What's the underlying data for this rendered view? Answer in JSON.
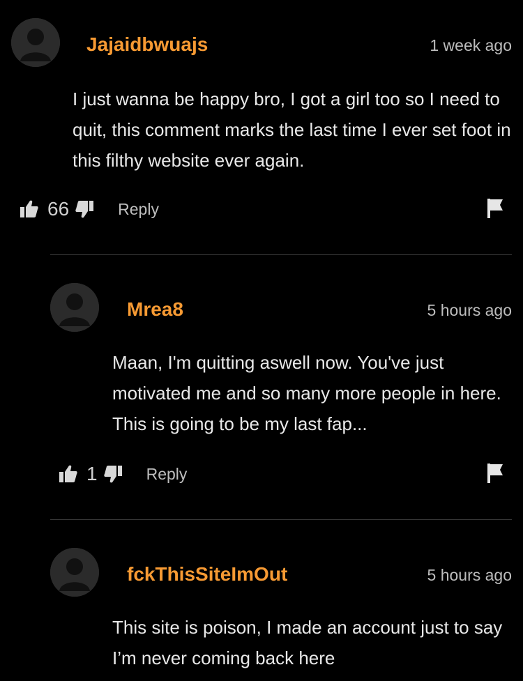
{
  "comments": [
    {
      "username": "Jajaidbwuajs",
      "timestamp": "1 week ago",
      "text": "I just wanna be happy bro, I got a girl too so I need to quit, this comment marks the last time I ever set foot in this filthy website ever again.",
      "likes": "66",
      "reply_label": "Reply"
    },
    {
      "username": "Mrea8",
      "timestamp": "5 hours ago",
      "text": "Maan, I'm quitting aswell now. You've just motivated me and so many more people in here. This is going to be my last fap...",
      "likes": "1",
      "reply_label": "Reply"
    },
    {
      "username": "fckThisSiteImOut",
      "timestamp": "5 hours ago",
      "text": "This site is poison, I made an account just to say I’m never coming back here"
    }
  ],
  "colors": {
    "background": "#000000",
    "username": "#f79a33",
    "text": "#e8e8e8",
    "muted": "#bdbdbd",
    "avatar_bg": "#2b2b2b",
    "divider": "#3a3a3a"
  },
  "icons": [
    "avatar-placeholder-icon",
    "thumbs-up-icon",
    "thumbs-down-icon",
    "flag-icon"
  ]
}
